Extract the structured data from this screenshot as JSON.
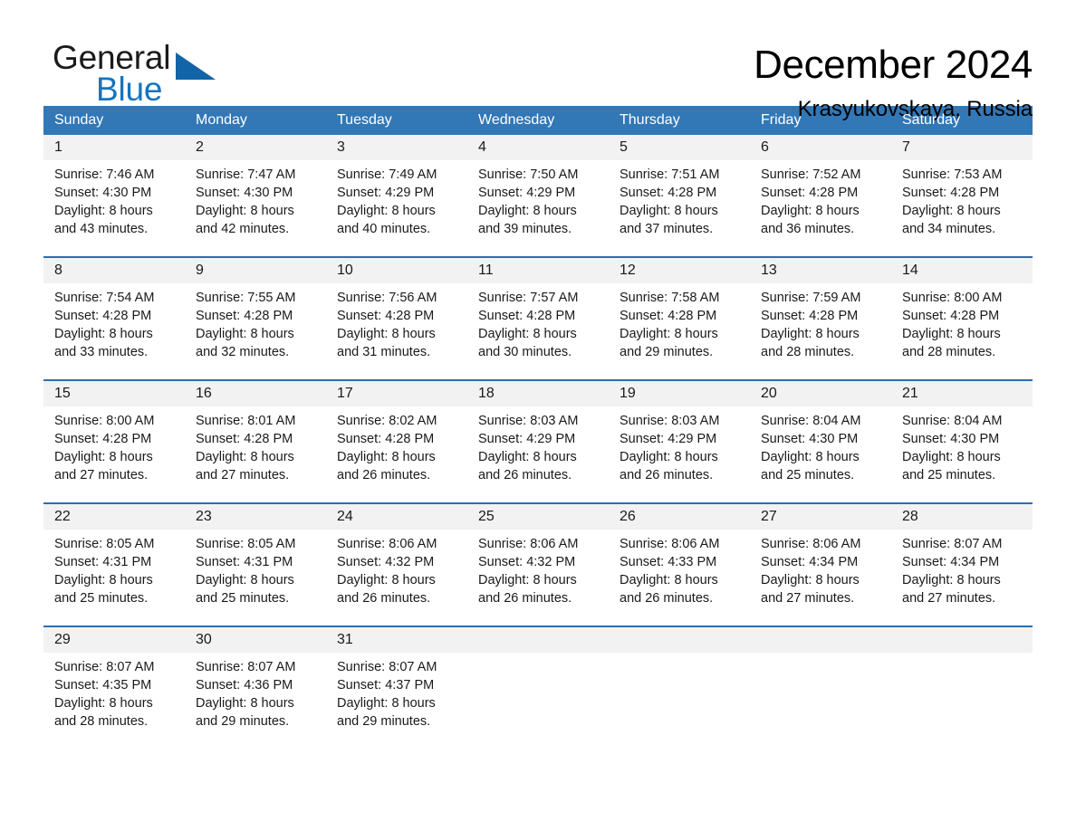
{
  "brand": {
    "name_top": "General",
    "name_bottom": "Blue",
    "accent_color": "#1574bf",
    "triangle_color": "#1264a8"
  },
  "header": {
    "month_title": "December 2024",
    "location": "Krasyukovskaya, Russia"
  },
  "calendar": {
    "header_bg": "#3277b6",
    "header_text_color": "#ffffff",
    "daynum_band_bg": "#f2f2f2",
    "week_divider_color": "#2a6fb0",
    "weekdays": [
      "Sunday",
      "Monday",
      "Tuesday",
      "Wednesday",
      "Thursday",
      "Friday",
      "Saturday"
    ],
    "weeks": [
      {
        "days": [
          {
            "num": "1",
            "sunrise": "Sunrise: 7:46 AM",
            "sunset": "Sunset: 4:30 PM",
            "daylight_1": "Daylight: 8 hours",
            "daylight_2": "and 43 minutes."
          },
          {
            "num": "2",
            "sunrise": "Sunrise: 7:47 AM",
            "sunset": "Sunset: 4:30 PM",
            "daylight_1": "Daylight: 8 hours",
            "daylight_2": "and 42 minutes."
          },
          {
            "num": "3",
            "sunrise": "Sunrise: 7:49 AM",
            "sunset": "Sunset: 4:29 PM",
            "daylight_1": "Daylight: 8 hours",
            "daylight_2": "and 40 minutes."
          },
          {
            "num": "4",
            "sunrise": "Sunrise: 7:50 AM",
            "sunset": "Sunset: 4:29 PM",
            "daylight_1": "Daylight: 8 hours",
            "daylight_2": "and 39 minutes."
          },
          {
            "num": "5",
            "sunrise": "Sunrise: 7:51 AM",
            "sunset": "Sunset: 4:28 PM",
            "daylight_1": "Daylight: 8 hours",
            "daylight_2": "and 37 minutes."
          },
          {
            "num": "6",
            "sunrise": "Sunrise: 7:52 AM",
            "sunset": "Sunset: 4:28 PM",
            "daylight_1": "Daylight: 8 hours",
            "daylight_2": "and 36 minutes."
          },
          {
            "num": "7",
            "sunrise": "Sunrise: 7:53 AM",
            "sunset": "Sunset: 4:28 PM",
            "daylight_1": "Daylight: 8 hours",
            "daylight_2": "and 34 minutes."
          }
        ]
      },
      {
        "days": [
          {
            "num": "8",
            "sunrise": "Sunrise: 7:54 AM",
            "sunset": "Sunset: 4:28 PM",
            "daylight_1": "Daylight: 8 hours",
            "daylight_2": "and 33 minutes."
          },
          {
            "num": "9",
            "sunrise": "Sunrise: 7:55 AM",
            "sunset": "Sunset: 4:28 PM",
            "daylight_1": "Daylight: 8 hours",
            "daylight_2": "and 32 minutes."
          },
          {
            "num": "10",
            "sunrise": "Sunrise: 7:56 AM",
            "sunset": "Sunset: 4:28 PM",
            "daylight_1": "Daylight: 8 hours",
            "daylight_2": "and 31 minutes."
          },
          {
            "num": "11",
            "sunrise": "Sunrise: 7:57 AM",
            "sunset": "Sunset: 4:28 PM",
            "daylight_1": "Daylight: 8 hours",
            "daylight_2": "and 30 minutes."
          },
          {
            "num": "12",
            "sunrise": "Sunrise: 7:58 AM",
            "sunset": "Sunset: 4:28 PM",
            "daylight_1": "Daylight: 8 hours",
            "daylight_2": "and 29 minutes."
          },
          {
            "num": "13",
            "sunrise": "Sunrise: 7:59 AM",
            "sunset": "Sunset: 4:28 PM",
            "daylight_1": "Daylight: 8 hours",
            "daylight_2": "and 28 minutes."
          },
          {
            "num": "14",
            "sunrise": "Sunrise: 8:00 AM",
            "sunset": "Sunset: 4:28 PM",
            "daylight_1": "Daylight: 8 hours",
            "daylight_2": "and 28 minutes."
          }
        ]
      },
      {
        "days": [
          {
            "num": "15",
            "sunrise": "Sunrise: 8:00 AM",
            "sunset": "Sunset: 4:28 PM",
            "daylight_1": "Daylight: 8 hours",
            "daylight_2": "and 27 minutes."
          },
          {
            "num": "16",
            "sunrise": "Sunrise: 8:01 AM",
            "sunset": "Sunset: 4:28 PM",
            "daylight_1": "Daylight: 8 hours",
            "daylight_2": "and 27 minutes."
          },
          {
            "num": "17",
            "sunrise": "Sunrise: 8:02 AM",
            "sunset": "Sunset: 4:28 PM",
            "daylight_1": "Daylight: 8 hours",
            "daylight_2": "and 26 minutes."
          },
          {
            "num": "18",
            "sunrise": "Sunrise: 8:03 AM",
            "sunset": "Sunset: 4:29 PM",
            "daylight_1": "Daylight: 8 hours",
            "daylight_2": "and 26 minutes."
          },
          {
            "num": "19",
            "sunrise": "Sunrise: 8:03 AM",
            "sunset": "Sunset: 4:29 PM",
            "daylight_1": "Daylight: 8 hours",
            "daylight_2": "and 26 minutes."
          },
          {
            "num": "20",
            "sunrise": "Sunrise: 8:04 AM",
            "sunset": "Sunset: 4:30 PM",
            "daylight_1": "Daylight: 8 hours",
            "daylight_2": "and 25 minutes."
          },
          {
            "num": "21",
            "sunrise": "Sunrise: 8:04 AM",
            "sunset": "Sunset: 4:30 PM",
            "daylight_1": "Daylight: 8 hours",
            "daylight_2": "and 25 minutes."
          }
        ]
      },
      {
        "days": [
          {
            "num": "22",
            "sunrise": "Sunrise: 8:05 AM",
            "sunset": "Sunset: 4:31 PM",
            "daylight_1": "Daylight: 8 hours",
            "daylight_2": "and 25 minutes."
          },
          {
            "num": "23",
            "sunrise": "Sunrise: 8:05 AM",
            "sunset": "Sunset: 4:31 PM",
            "daylight_1": "Daylight: 8 hours",
            "daylight_2": "and 25 minutes."
          },
          {
            "num": "24",
            "sunrise": "Sunrise: 8:06 AM",
            "sunset": "Sunset: 4:32 PM",
            "daylight_1": "Daylight: 8 hours",
            "daylight_2": "and 26 minutes."
          },
          {
            "num": "25",
            "sunrise": "Sunrise: 8:06 AM",
            "sunset": "Sunset: 4:32 PM",
            "daylight_1": "Daylight: 8 hours",
            "daylight_2": "and 26 minutes."
          },
          {
            "num": "26",
            "sunrise": "Sunrise: 8:06 AM",
            "sunset": "Sunset: 4:33 PM",
            "daylight_1": "Daylight: 8 hours",
            "daylight_2": "and 26 minutes."
          },
          {
            "num": "27",
            "sunrise": "Sunrise: 8:06 AM",
            "sunset": "Sunset: 4:34 PM",
            "daylight_1": "Daylight: 8 hours",
            "daylight_2": "and 27 minutes."
          },
          {
            "num": "28",
            "sunrise": "Sunrise: 8:07 AM",
            "sunset": "Sunset: 4:34 PM",
            "daylight_1": "Daylight: 8 hours",
            "daylight_2": "and 27 minutes."
          }
        ]
      },
      {
        "days": [
          {
            "num": "29",
            "sunrise": "Sunrise: 8:07 AM",
            "sunset": "Sunset: 4:35 PM",
            "daylight_1": "Daylight: 8 hours",
            "daylight_2": "and 28 minutes."
          },
          {
            "num": "30",
            "sunrise": "Sunrise: 8:07 AM",
            "sunset": "Sunset: 4:36 PM",
            "daylight_1": "Daylight: 8 hours",
            "daylight_2": "and 29 minutes."
          },
          {
            "num": "31",
            "sunrise": "Sunrise: 8:07 AM",
            "sunset": "Sunset: 4:37 PM",
            "daylight_1": "Daylight: 8 hours",
            "daylight_2": "and 29 minutes."
          },
          {
            "num": "",
            "sunrise": "",
            "sunset": "",
            "daylight_1": "",
            "daylight_2": ""
          },
          {
            "num": "",
            "sunrise": "",
            "sunset": "",
            "daylight_1": "",
            "daylight_2": ""
          },
          {
            "num": "",
            "sunrise": "",
            "sunset": "",
            "daylight_1": "",
            "daylight_2": ""
          },
          {
            "num": "",
            "sunrise": "",
            "sunset": "",
            "daylight_1": "",
            "daylight_2": ""
          }
        ]
      }
    ]
  }
}
